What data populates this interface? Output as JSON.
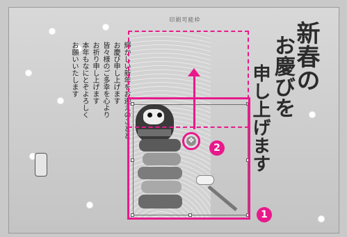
{
  "print_area": {
    "label": "印刷可能枠"
  },
  "message": {
    "lines": [
      "輝かしい新年をお迎えのことと",
      "お慶び申し上げます",
      "皆々様のご多幸を心より",
      "お祈り申し上げます",
      "本年もなにとぞよろしく",
      "お願いいたします"
    ]
  },
  "calligraphy": {
    "col_a": "新春の",
    "col_b": "お慶びを",
    "col_c": "申し上げます"
  },
  "annotations": {
    "badge_1": "1",
    "badge_2": "2",
    "move_handle_glyph": "✥"
  },
  "colors": {
    "annotation_accent": "#e8198b",
    "card_background": "#d3d3d3",
    "ink": "#222222"
  },
  "icons": {
    "move_handle": "move-cross-icon",
    "daruma_image": "daruma-illustration",
    "mallet_image": "mallet-illustration"
  }
}
